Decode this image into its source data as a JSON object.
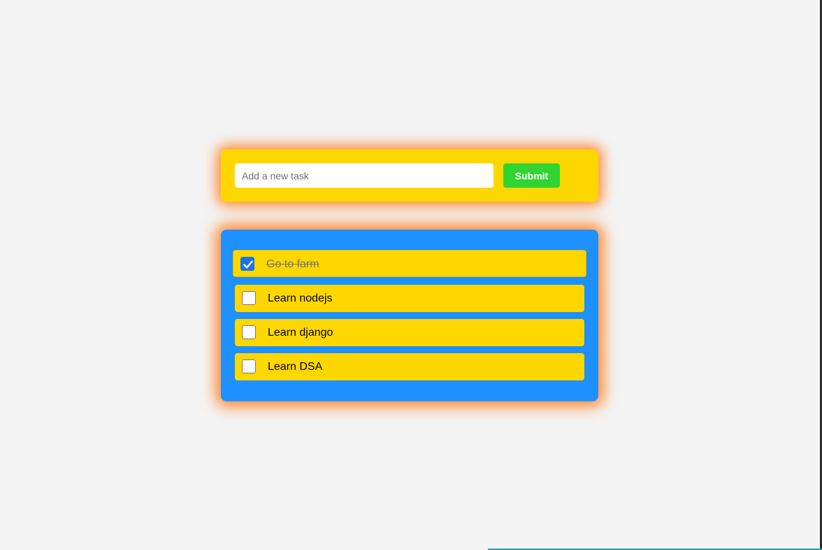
{
  "form": {
    "input_placeholder": "Add a new task",
    "input_value": "",
    "submit_label": "Submit"
  },
  "tasks": [
    {
      "label": "Go to farm",
      "completed": true
    },
    {
      "label": "Learn nodejs",
      "completed": false
    },
    {
      "label": "Learn django",
      "completed": false
    },
    {
      "label": "Learn DSA",
      "completed": false
    }
  ],
  "colors": {
    "page_background": "#f4f4f4",
    "form_card": "#ffd700",
    "list_card": "#1e90ff",
    "task_item": "#ffd700",
    "submit_button": "#32d432",
    "glow": "#ff7814",
    "checkbox_checked": "#1a73e8"
  },
  "icons": {
    "checked": "check-icon"
  }
}
